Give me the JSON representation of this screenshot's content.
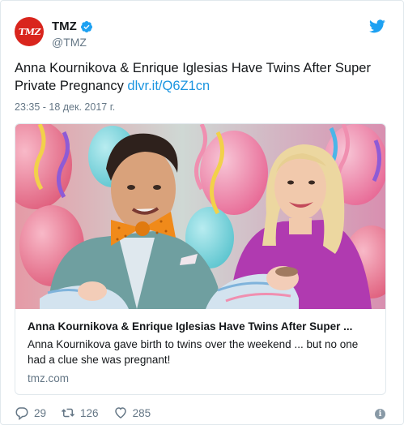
{
  "account": {
    "display_name": "TMZ",
    "handle": "@TMZ",
    "avatar_text": "TMZ",
    "verified": true
  },
  "tweet": {
    "text": "Anna Kournikova & Enrique Iglesias Have Twins After Super Private Pregnancy ",
    "link": "dlvr.it/Q6Z1cn",
    "timestamp": "23:35 - 18 дек. 2017 г."
  },
  "card": {
    "title": "Anna Kournikova & Enrique Iglesias Have Twins After Super ...",
    "description": "Anna Kournikova gave birth to twins over the weekend ... but no one had a clue she was pregnant!",
    "domain": "tmz.com"
  },
  "actions": {
    "replies": "29",
    "retweets": "126",
    "likes": "285"
  },
  "icons": {
    "bird": "twitter-bird-icon",
    "verified": "verified-badge-icon",
    "reply": "reply-icon",
    "retweet": "retweet-icon",
    "like": "heart-icon",
    "info": "info-icon"
  },
  "colors": {
    "link": "#1b95e0",
    "muted": "#657786",
    "brand_red": "#d9251d",
    "twitter_blue": "#1da1f2"
  }
}
